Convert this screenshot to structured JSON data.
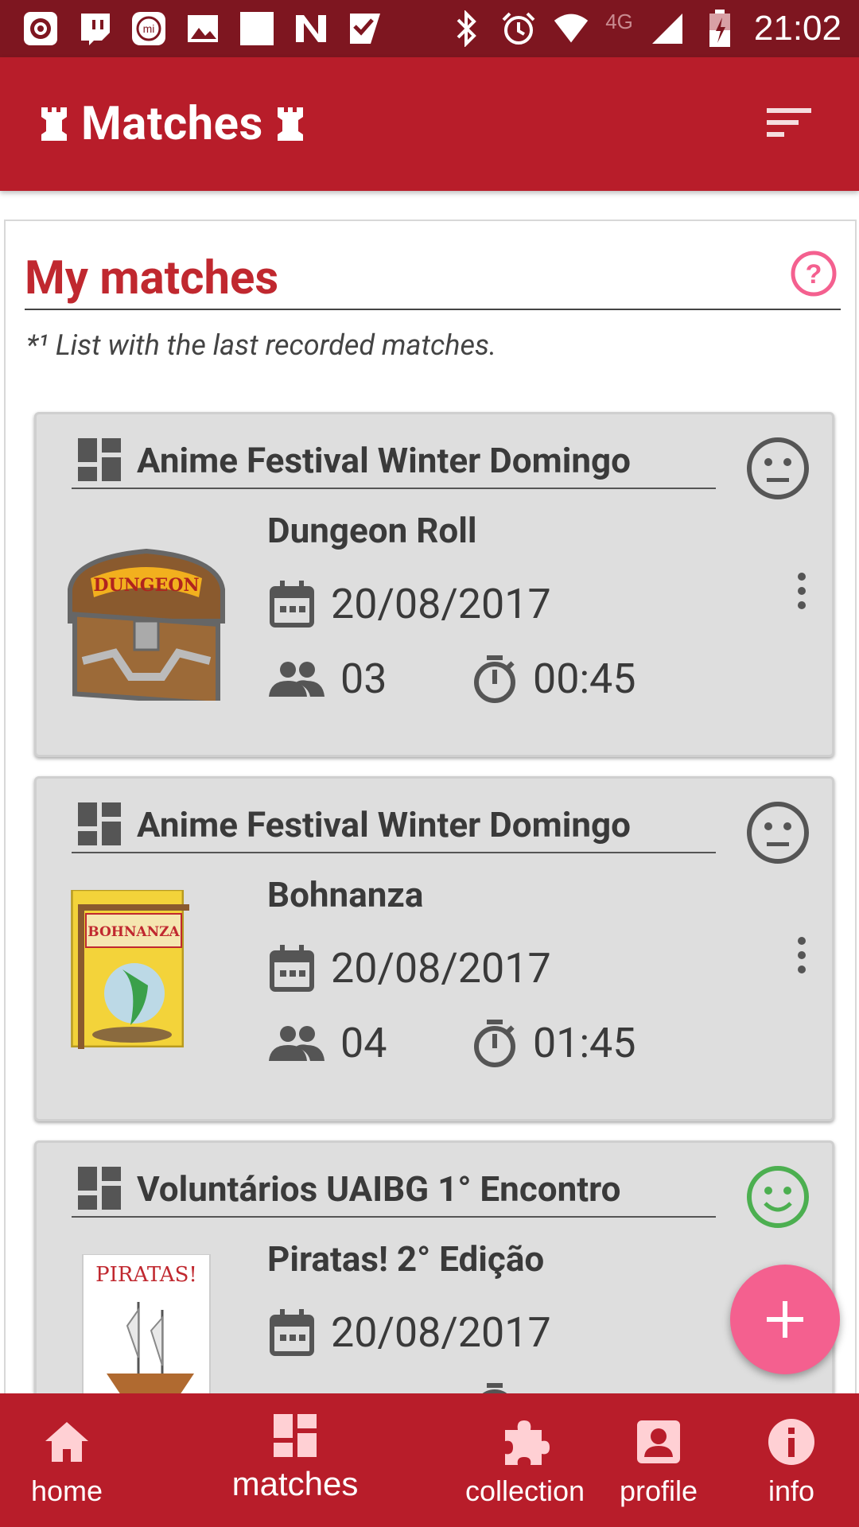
{
  "status_bar": {
    "time": "21:02",
    "network": "4G"
  },
  "app_bar": {
    "title": "Matches"
  },
  "section": {
    "title": "My matches",
    "note": "*¹ List with the last recorded matches."
  },
  "matches": [
    {
      "event": "Anime Festival Winter Domingo",
      "game": "Dungeon Roll",
      "date": "20/08/2017",
      "players": "03",
      "duration": "00:45",
      "mood": "neutral",
      "mood_color": "#555555"
    },
    {
      "event": "Anime Festival Winter Domingo",
      "game": "Bohnanza",
      "date": "20/08/2017",
      "players": "04",
      "duration": "01:45",
      "mood": "neutral",
      "mood_color": "#555555"
    },
    {
      "event": "Voluntários UAIBG 1° Encontro",
      "game": "Piratas! 2° Edição",
      "date": "20/08/2017",
      "players": "",
      "duration": "",
      "mood": "happy",
      "mood_color": "#4caf50"
    }
  ],
  "bottom_nav": [
    {
      "label": "home",
      "icon": "home-icon"
    },
    {
      "label": "matches",
      "icon": "dashboard-icon",
      "active": true
    },
    {
      "label": "collection",
      "icon": "puzzle-icon"
    },
    {
      "label": "profile",
      "icon": "profile-icon"
    },
    {
      "label": "info",
      "icon": "info-icon"
    }
  ],
  "colors": {
    "primary": "#b81d2a",
    "status_bar": "#7e1620",
    "accent": "#f4608f",
    "title": "#c0282f"
  }
}
